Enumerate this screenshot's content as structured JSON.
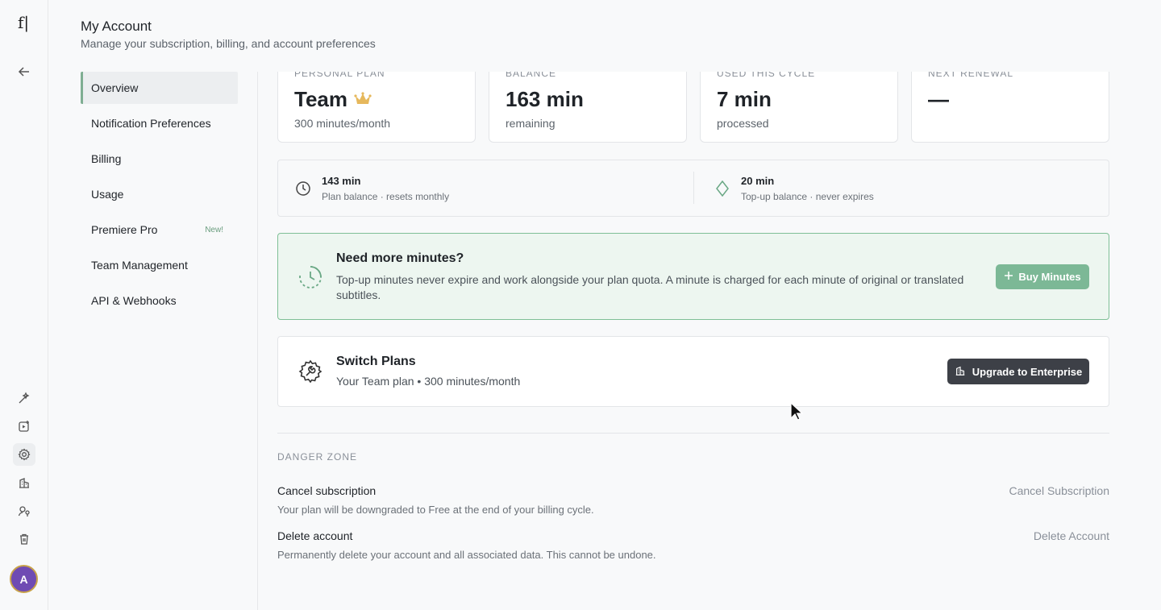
{
  "rail": {
    "logo": "f|",
    "avatar_initial": "A"
  },
  "header": {
    "title": "My Account",
    "subtitle": "Manage your subscription, billing, and account preferences"
  },
  "subnav": {
    "items": [
      {
        "label": "Overview",
        "active": true
      },
      {
        "label": "Notification Preferences"
      },
      {
        "label": "Billing"
      },
      {
        "label": "Usage"
      },
      {
        "label": "Premiere Pro",
        "badge": "New!"
      },
      {
        "label": "Team Management"
      },
      {
        "label": "API & Webhooks"
      }
    ]
  },
  "stats": [
    {
      "label": "PERSONAL PLAN",
      "value": "Team",
      "sub": "300 minutes/month"
    },
    {
      "label": "BALANCE",
      "value": "163 min",
      "sub": "remaining"
    },
    {
      "label": "USED THIS CYCLE",
      "value": "7 min",
      "sub": "processed"
    },
    {
      "label": "NEXT RENEWAL",
      "value": "—",
      "sub": ""
    }
  ],
  "balances": {
    "plan": {
      "value": "143 min",
      "sub": "Plan balance · resets monthly"
    },
    "topup": {
      "value": "20 min",
      "sub": "Top-up balance · never expires"
    }
  },
  "promo": {
    "title": "Need more minutes?",
    "description": "Top-up minutes never expire and work alongside your plan quota. A minute is charged for each minute of original or translated subtitles.",
    "button": "Buy Minutes"
  },
  "switch_plans": {
    "title": "Switch Plans",
    "description": "Your Team plan • 300 minutes/month",
    "button": "Upgrade to Enterprise"
  },
  "danger_zone": {
    "title": "DANGER ZONE",
    "cancel": {
      "title": "Cancel subscription",
      "description": "Your plan will be downgraded to Free at the end of your billing cycle.",
      "action": "Cancel Subscription"
    },
    "delete": {
      "title": "Delete account",
      "description": "Permanently delete your account and all associated data. This cannot be undone.",
      "action": "Delete Account"
    }
  },
  "colors": {
    "accent_green": "#7cb896",
    "promo_bg": "#edf6f0",
    "dark_button": "#3d4047",
    "avatar": "#6f4bb3"
  }
}
